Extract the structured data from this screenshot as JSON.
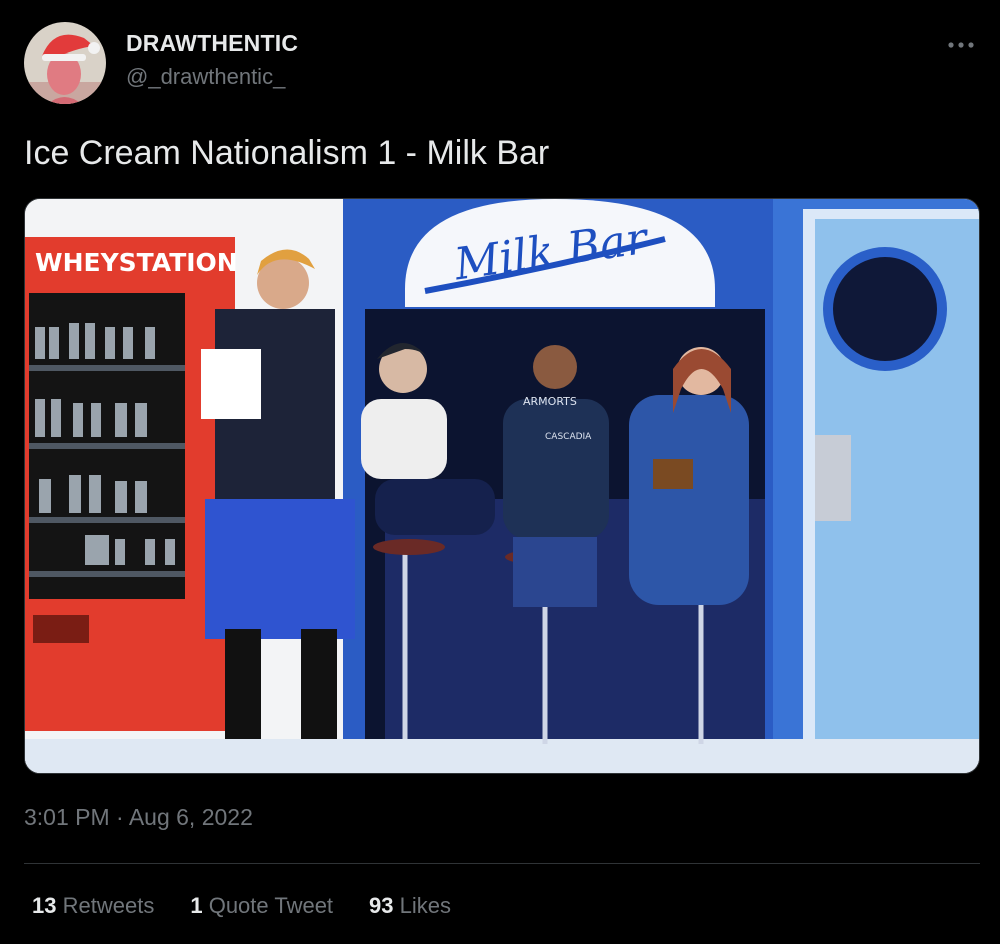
{
  "author": {
    "display_name": "DRAWTHENTIC",
    "handle": "@_drawthentic_"
  },
  "tweet": {
    "text": "Ice Cream Nationalism 1 - Milk Bar",
    "timestamp": "3:01 PM · Aug 6, 2022"
  },
  "media": {
    "sign_vending": "WHEYSTATION",
    "sign_bar": "Milk Bar",
    "jacket_text": "ARMORTS",
    "apron_text": "CASCADIA"
  },
  "stats": {
    "retweets_count": "13",
    "retweets_label": "Retweets",
    "quotes_count": "1",
    "quotes_label": "Quote Tweet",
    "likes_count": "93",
    "likes_label": "Likes"
  },
  "icons": {
    "more": "more-horizontal-icon",
    "avatar": "user-avatar"
  }
}
